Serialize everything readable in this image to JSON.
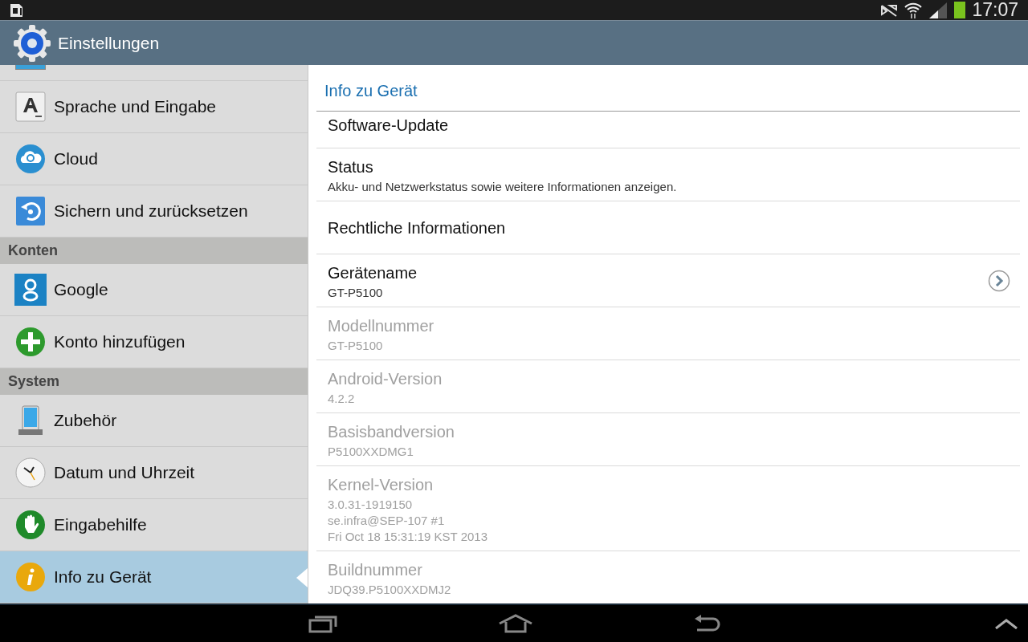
{
  "status_bar": {
    "time": "17:07"
  },
  "action_bar": {
    "title": "Einstellungen"
  },
  "sidebar": {
    "items": [
      {
        "kind": "item",
        "label": "Sprache und Eingabe",
        "selected": false
      },
      {
        "kind": "item",
        "label": "Cloud",
        "selected": false
      },
      {
        "kind": "item",
        "label": "Sichern und zurücksetzen",
        "selected": false
      },
      {
        "kind": "header",
        "label": "Konten"
      },
      {
        "kind": "item",
        "label": "Google",
        "selected": false
      },
      {
        "kind": "item",
        "label": "Konto hinzufügen",
        "selected": false
      },
      {
        "kind": "header",
        "label": "System"
      },
      {
        "kind": "item",
        "label": "Zubehör",
        "selected": false
      },
      {
        "kind": "item",
        "label": "Datum und Uhrzeit",
        "selected": false
      },
      {
        "kind": "item",
        "label": "Eingabehilfe",
        "selected": false
      },
      {
        "kind": "item",
        "label": "Info zu Gerät",
        "selected": true
      }
    ]
  },
  "detail": {
    "title": "Info zu Gerät",
    "rows": [
      {
        "title": "Software-Update",
        "summary": [],
        "disabled": false,
        "chevron": false
      },
      {
        "title": "Status",
        "summary": [
          "Akku- und Netzwerkstatus sowie weitere Informationen anzeigen."
        ],
        "disabled": false,
        "chevron": false
      },
      {
        "title": "Rechtliche Informationen",
        "summary": [],
        "disabled": false,
        "chevron": false
      },
      {
        "title": "Gerätename",
        "summary": [
          "GT-P5100"
        ],
        "disabled": false,
        "chevron": true
      },
      {
        "title": "Modellnummer",
        "summary": [
          "GT-P5100"
        ],
        "disabled": true,
        "chevron": false
      },
      {
        "title": "Android-Version",
        "summary": [
          "4.2.2"
        ],
        "disabled": true,
        "chevron": false
      },
      {
        "title": "Basisbandversion",
        "summary": [
          "P5100XXDMG1"
        ],
        "disabled": true,
        "chevron": false
      },
      {
        "title": "Kernel-Version",
        "summary": [
          "3.0.31-1919150",
          "se.infra@SEP-107 #1",
          "Fri Oct 18 15:31:19 KST 2013"
        ],
        "disabled": true,
        "chevron": false
      },
      {
        "title": "Buildnummer",
        "summary": [
          "JDQ39.P5100XXDMJ2"
        ],
        "disabled": true,
        "chevron": false
      }
    ]
  }
}
